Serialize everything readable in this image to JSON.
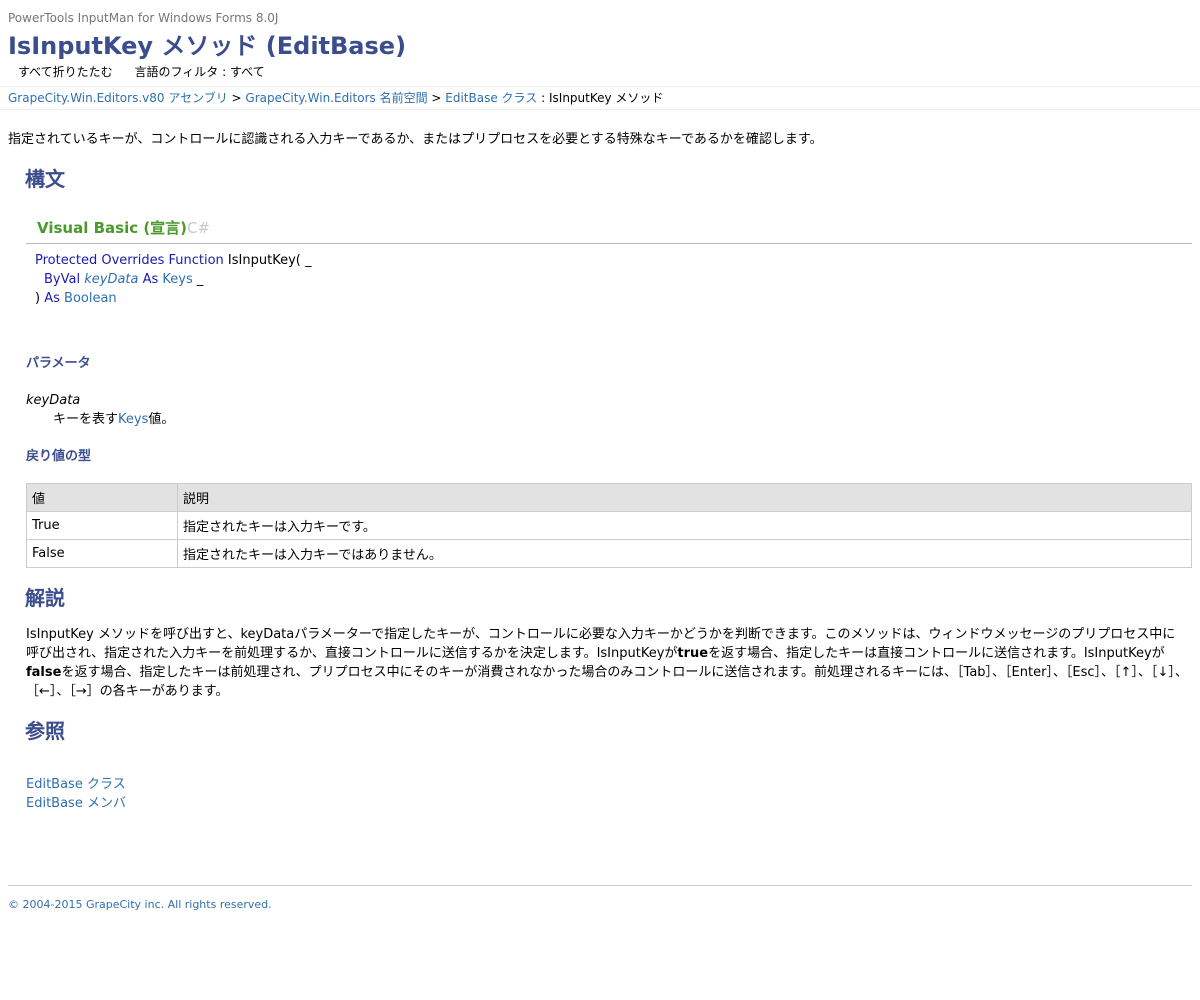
{
  "header": {
    "product": "PowerTools InputMan for Windows Forms 8.0J",
    "title": "IsInputKey メソッド (EditBase)",
    "collapse_all": "すべて折りたたむ",
    "language_filter": "言語のフィルタ : すべて"
  },
  "breadcrumb": {
    "assembly": "GrapeCity.Win.Editors.v80 アセンブリ",
    "sep1": " > ",
    "namespace": "GrapeCity.Win.Editors 名前空間",
    "sep2": " > ",
    "class": "EditBase クラス",
    "current": " : IsInputKey メソッド"
  },
  "summary": "指定されているキーが、コントロールに認識される入力キーであるか、またはプリプロセスを必要とする特殊なキーであるかを確認します。",
  "syntax": {
    "heading": "構文",
    "tabs": {
      "vb": "Visual Basic (宣言)",
      "cs": "C#"
    },
    "code": {
      "line1_kw": "Protected Overrides Function",
      "line1_rest": " IsInputKey( _",
      "line2_kw": "ByVal",
      "line2_param": "keyData",
      "line2_as": " As ",
      "line2_type": "Keys",
      "line2_tail": " _",
      "line3_close": ") ",
      "line3_as": "As",
      "line3_type": "Boolean"
    }
  },
  "parameters": {
    "heading": "パラメータ",
    "name": "keyData",
    "desc_before": "キーを表す",
    "desc_link": "Keys",
    "desc_after": "値。"
  },
  "return_value": {
    "heading": "戻り値の型",
    "columns": [
      "値",
      "説明"
    ],
    "rows": [
      [
        "True",
        "指定されたキーは入力キーです。"
      ],
      [
        "False",
        "指定されたキーは入力キーではありません。"
      ]
    ]
  },
  "remarks": {
    "heading": "解説",
    "part1": "IsInputKey メソッドを呼び出すと、keyDataパラメーターで指定したキーが、コントロールに必要な入力キーかどうかを判断できます。このメソッドは、ウィンドウメッセージのプリプロセス中に呼び出され、指定された入力キーを前処理するか、直接コントロールに送信するかを決定します。IsInputKeyが",
    "bold1": "true",
    "part2": "を返す場合、指定したキーは直接コントロールに送信されます。IsInputKeyが",
    "bold2": "false",
    "part3": "を返す場合、指定したキーは前処理され、プリプロセス中にそのキーが消費されなかった場合のみコントロールに送信されます。前処理されるキーには、［Tab］、［Enter］、［Esc］、［↑］、［↓］、［←］、［→］の各キーがあります。"
  },
  "see_also": {
    "heading": "参照",
    "links": [
      "EditBase クラス",
      "EditBase メンバ"
    ]
  },
  "footer": "© 2004-2015 GrapeCity inc. All rights reserved.",
  "colors": {
    "heading": "#3b4d8c",
    "link": "#2f6fb0",
    "tab_active": "#4a9a2a",
    "keyword": "#1a1ab0"
  }
}
